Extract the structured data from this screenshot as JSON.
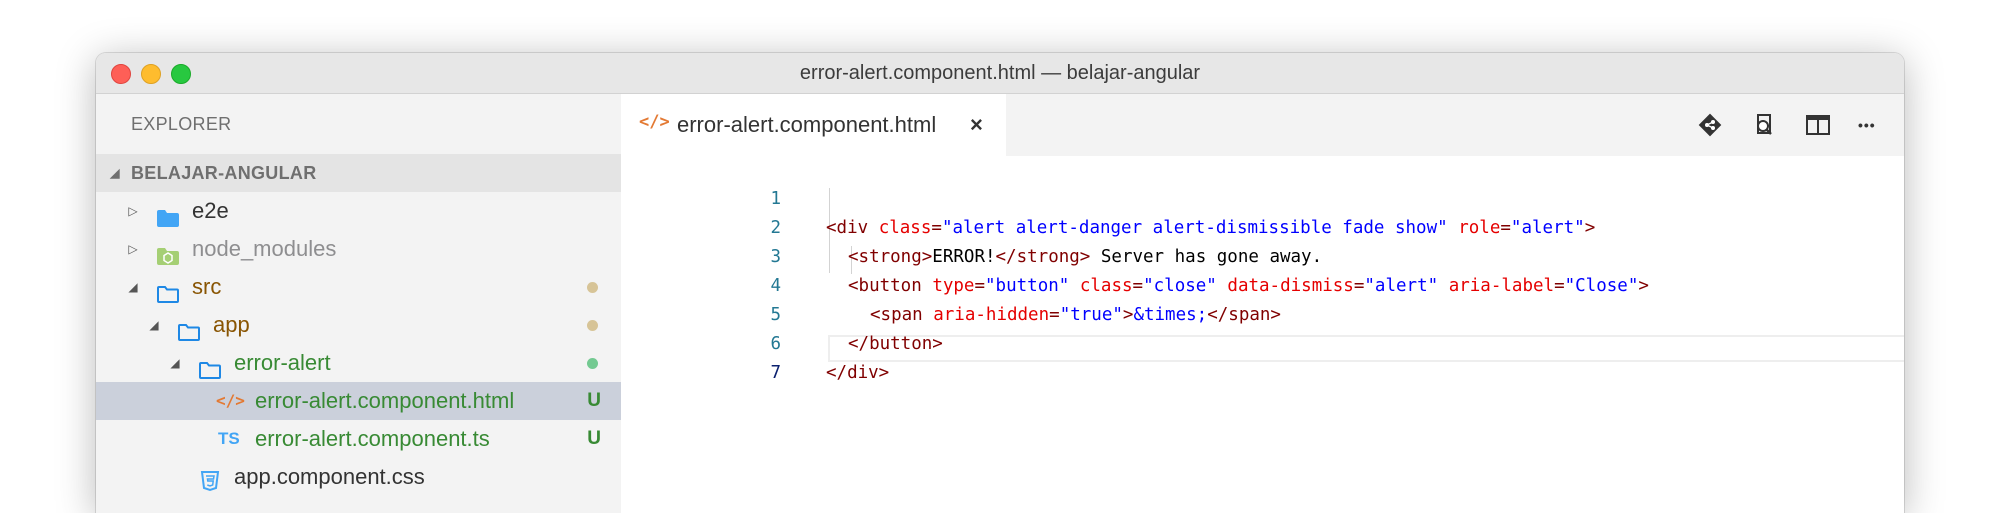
{
  "window": {
    "title": "error-alert.component.html — belajar-angular"
  },
  "explorer": {
    "title": "EXPLORER",
    "section": "BELAJAR-ANGULAR",
    "items": [
      {
        "label": "e2e",
        "icon": "folder-icon",
        "color": "#333333"
      },
      {
        "label": "node_modules",
        "icon": "node-modules-folder-icon",
        "color": "#8e8e90"
      },
      {
        "label": "src",
        "icon": "folder-open-icon",
        "color": "#895503",
        "status": "modified"
      },
      {
        "label": "app",
        "icon": "folder-open-icon",
        "color": "#895503",
        "status": "modified"
      },
      {
        "label": "error-alert",
        "icon": "folder-open-icon",
        "color": "#388a34",
        "status": "untracked"
      },
      {
        "label": "error-alert.component.html",
        "icon": "html-file-icon",
        "color": "#388a34",
        "badge": "U",
        "selected": true
      },
      {
        "label": "error-alert.component.ts",
        "icon": "typescript-file-icon",
        "color": "#388a34",
        "badge": "U",
        "icon_text": "TS"
      },
      {
        "label": "app.component.css",
        "icon": "css-file-icon",
        "color": "#333333"
      }
    ]
  },
  "editor": {
    "tab": {
      "label": "error-alert.component.html",
      "icon_text": "</>",
      "close": "×"
    },
    "actions": [
      "git-compare-icon",
      "open-preview-icon",
      "split-editor-icon",
      "more-actions-icon"
    ],
    "more_label": "•••",
    "lines": [
      {
        "n": "1"
      },
      {
        "n": "2",
        "text": "ERROR!",
        "text2": " Server has gone away."
      },
      {
        "n": "3"
      },
      {
        "n": "4",
        "entity": "&times;"
      },
      {
        "n": "5"
      },
      {
        "n": "6"
      },
      {
        "n": "7"
      }
    ],
    "tokens": {
      "div_open": "<div",
      "class_attr": "class",
      "eq": "=",
      "alert_classes": "\"alert alert-danger alert-dismissible fade show\"",
      "role_attr": "role",
      "role_val": "\"alert\"",
      "gt": ">",
      "strong_open": "<strong>",
      "strong_close": "</strong>",
      "button_open": "<button",
      "type_attr": "type",
      "type_val": "\"button\"",
      "close_class": "\"close\"",
      "dismiss_attr": "data-dismiss",
      "dismiss_val": "\"alert\"",
      "aria_label_attr": "aria-label",
      "aria_label_val": "\"Close\"",
      "span_open": "<span",
      "aria_hidden_attr": "aria-hidden",
      "aria_hidden_val": "\"true\"",
      "span_close": "</span>",
      "button_close": "</button>",
      "div_close": "</div>"
    }
  },
  "colors": {
    "modified": "#d7c497",
    "untracked": "#73c991",
    "badge_untracked": "#388a34",
    "tag": "#800000",
    "attr": "#e50000",
    "string": "#0000ff",
    "line_number": "#237893"
  }
}
